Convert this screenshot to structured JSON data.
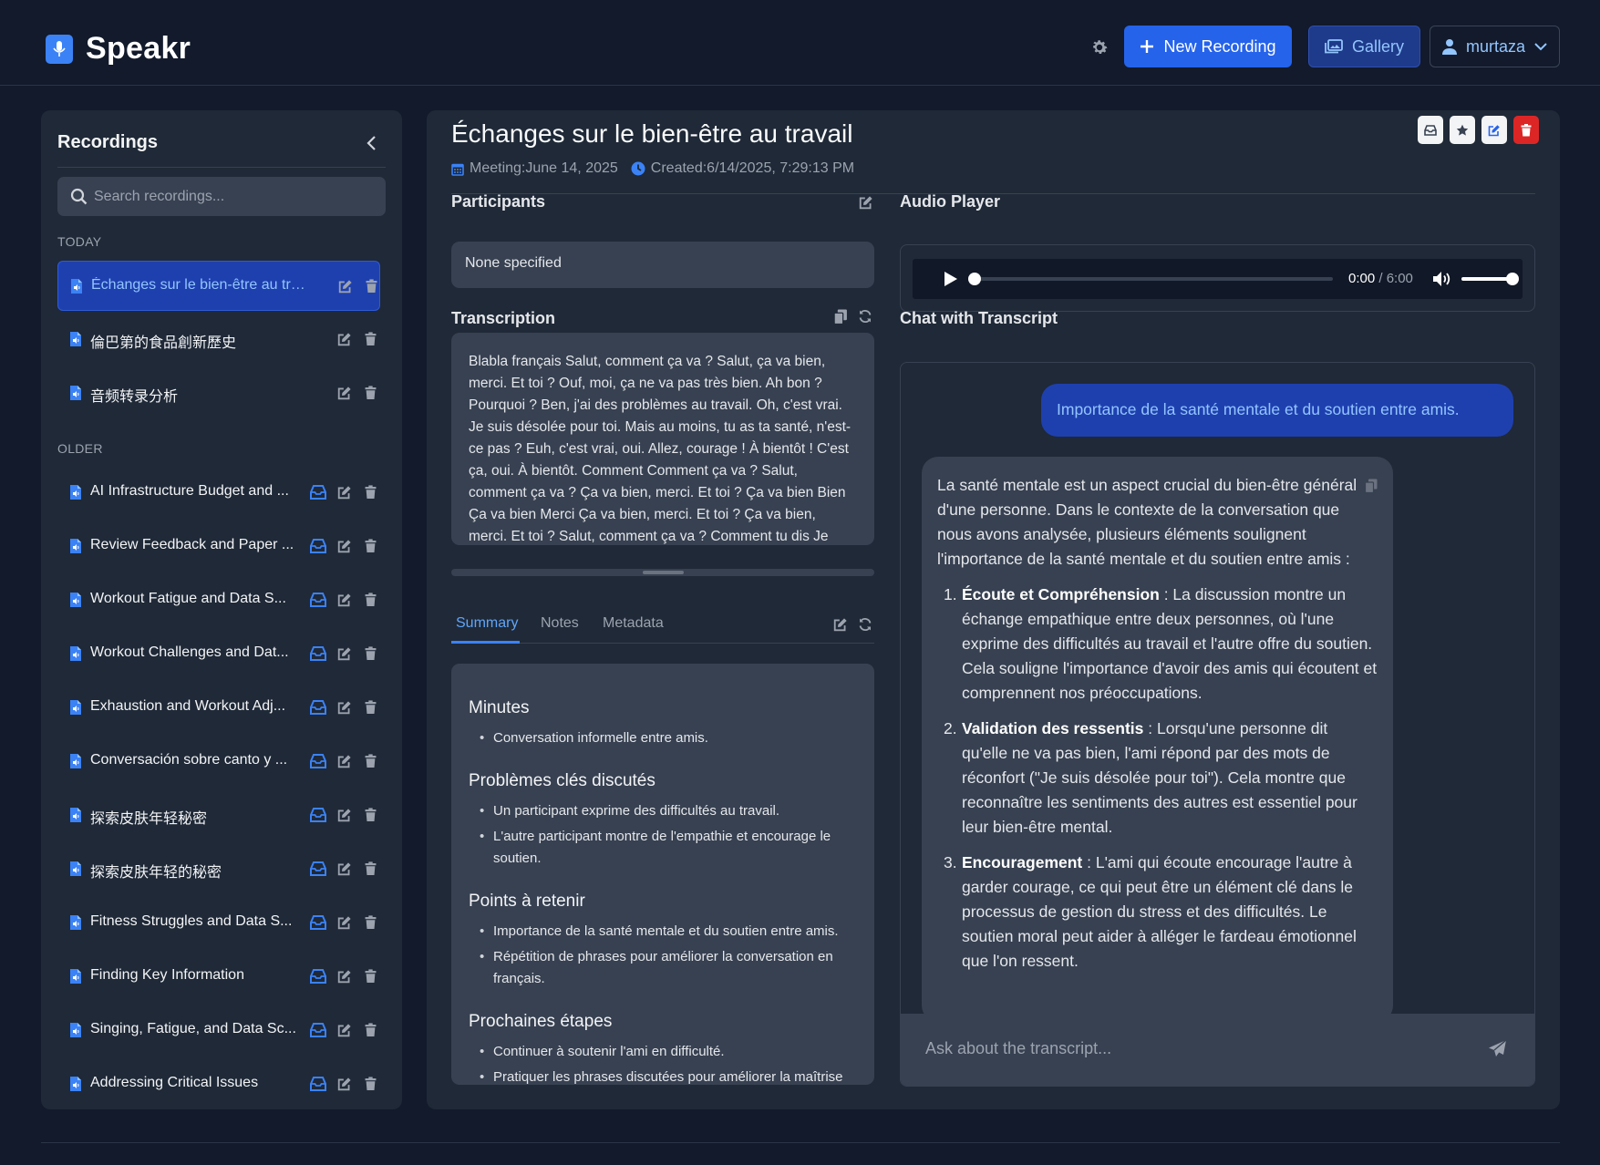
{
  "app": {
    "name": "Speakr"
  },
  "header": {
    "new_recording_label": "New Recording",
    "gallery_label": "Gallery",
    "user_label": "murtaza"
  },
  "sidebar": {
    "title": "Recordings",
    "search_placeholder": "Search recordings...",
    "today_label": "TODAY",
    "older_label": "OLDER",
    "today_items": [
      {
        "title": "Échanges sur le bien-être au trav...",
        "active": true
      },
      {
        "title": "倫巴第的食品創新歷史"
      },
      {
        "title": "音频转录分析"
      }
    ],
    "older_items": [
      {
        "title": "AI Infrastructure Budget and ..."
      },
      {
        "title": "Review Feedback and Paper ..."
      },
      {
        "title": "Workout Fatigue and Data S..."
      },
      {
        "title": "Workout Challenges and Dat..."
      },
      {
        "title": "Exhaustion and Workout Adj..."
      },
      {
        "title": "Conversación sobre canto y ..."
      },
      {
        "title": "探索皮肤年轻秘密"
      },
      {
        "title": "探索皮肤年轻的秘密"
      },
      {
        "title": "Fitness Struggles and Data S..."
      },
      {
        "title": "Finding Key Information"
      },
      {
        "title": "Singing, Fatigue, and Data Sc..."
      },
      {
        "title": "Addressing Critical Issues"
      }
    ]
  },
  "recording": {
    "title": "Échanges sur le bien-être au travail",
    "meeting": "Meeting:June 14, 2025",
    "created": "Created:6/14/2025, 7:29:13 PM"
  },
  "participants": {
    "label": "Participants",
    "value": "None specified"
  },
  "transcription": {
    "label": "Transcription",
    "text": "Blabla français Salut, comment ça va ? Salut, ça va bien, merci. Et toi ? Ouf, moi, ça ne va pas très bien. Ah bon ? Pourquoi ? Ben, j'ai des problèmes au travail. Oh, c'est vrai. Je suis désolée pour toi. Mais au moins, tu as ta santé, n'est-ce pas ? Euh, c'est vrai, oui. Allez, courage ! À bientôt ! C'est ça, oui. À bientôt. Comment Comment ça va ? Salut, comment ça va ? Ça va bien, merci. Et toi ? Ça va bien Bien Ça va bien Merci Ça va bien, merci. Et toi ? Ça va bien, merci. Et toi ? Salut, comment ça va ? Comment tu dis Je vais bien,"
  },
  "tabs": {
    "summary": "Summary",
    "notes": "Notes",
    "metadata": "Metadata"
  },
  "summary": {
    "sections": [
      {
        "heading": "Minutes",
        "items": [
          "Conversation informelle entre amis."
        ]
      },
      {
        "heading": "Problèmes clés discutés",
        "items": [
          "Un participant exprime des difficultés au travail.",
          "L'autre participant montre de l'empathie et encourage le soutien."
        ]
      },
      {
        "heading": "Points à retenir",
        "items": [
          "Importance de la santé mentale et du soutien entre amis.",
          "Répétition de phrases pour améliorer la conversation en français."
        ]
      },
      {
        "heading": "Prochaines étapes",
        "items": [
          "Continuer à soutenir l'ami en difficulté.",
          "Pratiquer les phrases discutées pour améliorer la maîtrise"
        ]
      }
    ]
  },
  "audio": {
    "label": "Audio Player",
    "current_time": "0:00",
    "total_time": "/ 6:00",
    "progress": 0,
    "volume": 1.0
  },
  "chat": {
    "label": "Chat with Transcript",
    "user_message": "Importance de la santé mentale et du soutien entre amis.",
    "bot_intro": "La santé mentale est un aspect crucial du bien-être général d'une personne. Dans le contexte de la conversation que nous avons analysée, plusieurs éléments soulignent l'importance de la santé mentale et du soutien entre amis :",
    "bot_points": [
      {
        "num": "1.",
        "title": "Écoute et Compréhension",
        "text": " : La discussion montre un échange empathique entre deux personnes, où l'une exprime des difficultés au travail et l'autre offre du soutien. Cela souligne l'importance d'avoir des amis qui écoutent et comprennent nos préoccupations."
      },
      {
        "num": "2.",
        "title": "Validation des ressentis",
        "text": " : Lorsqu'une personne dit qu'elle ne va pas bien, l'ami répond par des mots de réconfort (\"Je suis désolée pour toi\"). Cela montre que reconnaître les sentiments des autres est essentiel pour leur bien-être mental."
      },
      {
        "num": "3.",
        "title": "Encouragement",
        "text": " : L'ami qui écoute encourage l'autre à garder courage, ce qui peut être un élément clé dans le processus de gestion du stress et des difficultés. Le soutien moral peut aider à alléger le fardeau émotionnel que l'on ressent."
      }
    ],
    "input_placeholder": "Ask about the transcript..."
  },
  "colors": {
    "accent": "#3b82f6",
    "background": "#121a2b",
    "panel": "#1f2937",
    "danger": "#dc2626"
  }
}
